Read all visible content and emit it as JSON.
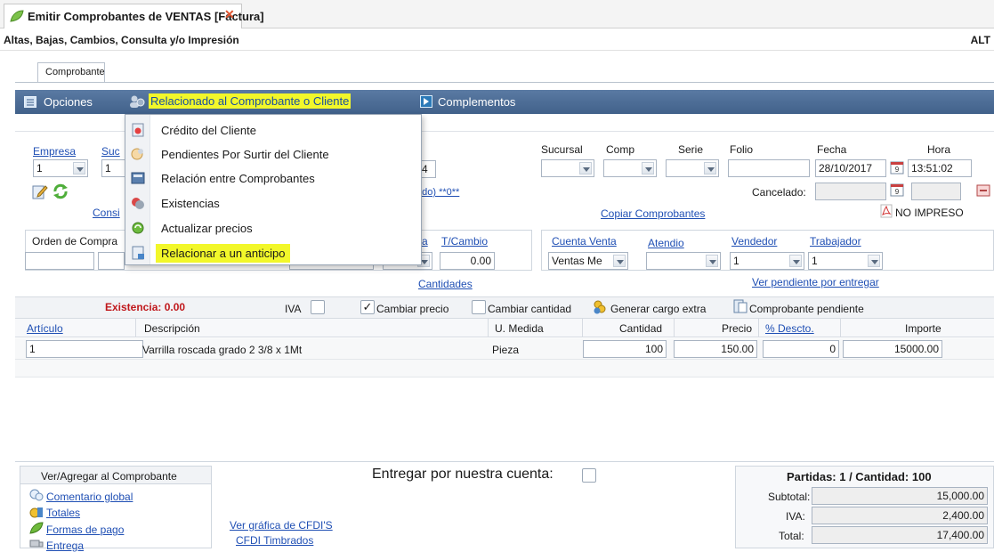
{
  "window": {
    "title": "Emitir Comprobantes de VENTAS [Factura]",
    "subtitle": "Altas, Bajas, Cambios, Consulta y/o Impresión",
    "mode_label": "ALT"
  },
  "tabs": [
    {
      "label": "Comprobante"
    }
  ],
  "toolbar": {
    "opciones": "Opciones",
    "relacionado": "Relacionado al Comprobante o Cliente",
    "complementos": "Complementos"
  },
  "menu": {
    "items": [
      {
        "label": "Crédito del Cliente",
        "icon": "credit-icon"
      },
      {
        "label": "Pendientes Por Surtir del Cliente",
        "icon": "pending-icon"
      },
      {
        "label": "Relación entre Comprobantes",
        "icon": "relation-icon"
      },
      {
        "label": "Existencias",
        "icon": "stock-icon"
      },
      {
        "label": "Actualizar precios",
        "icon": "update-prices-icon"
      },
      {
        "label": "Relacionar a un anticipo",
        "icon": "advance-icon"
      }
    ]
  },
  "header": {
    "empresa_label": "Empresa",
    "empresa_value": "1",
    "sucursal_short_label": "Suc",
    "sucursal_short_value": "1",
    "consig_label": "Consi",
    "hidden_value": "4",
    "status_text": "ado) **0**",
    "sucursal_label": "Sucursal",
    "comp_label": "Comp",
    "serie_label": "Serie",
    "folio_label": "Folio",
    "fecha_label": "Fecha",
    "fecha_value": "28/10/2017",
    "hora_label": "Hora",
    "hora_value": "13:51:02",
    "cancelado_label": "Cancelado:",
    "copiar_link": "Copiar Comprobantes",
    "no_impreso": "NO IMPRESO"
  },
  "row2": {
    "orden_label": "Orden de Compra",
    "a_label": "a",
    "tcambio_label": "T/Cambio",
    "tcambio_value": "0.00",
    "cuenta_venta_label": "Cuenta Venta",
    "cuenta_venta_value": "Ventas Me",
    "atendio_label": "Atendio",
    "vendedor_label": "Vendedor",
    "vendedor_value": "1",
    "trabajador_label": "Trabajador",
    "trabajador_value": "1",
    "cantidades_link": "Cantidades",
    "ver_pendiente_link": "Ver pendiente por entregar"
  },
  "items_toolbar": {
    "existencia": "Existencia: 0.00",
    "iva_label": "IVA",
    "cambiar_precio": "Cambiar precio",
    "cambiar_cantidad": "Cambiar cantidad",
    "generar_cargo": "Generar cargo extra",
    "comprobante_pendiente": "Comprobante pendiente"
  },
  "table": {
    "headers": [
      "Artículo",
      "Descripción",
      "U. Medida",
      "Cantidad",
      "Precio",
      "% Descto.",
      "Importe"
    ],
    "rows": [
      {
        "articulo": "1",
        "descripcion": "Varrilla roscada grado 2 3/8 x 1Mt",
        "unidad": "Pieza",
        "cantidad": "100",
        "precio": "150.00",
        "descuento": "0",
        "importe": "15000.00"
      }
    ]
  },
  "footer": {
    "ver_agregar_title": "Ver/Agregar al Comprobante",
    "comentario_link": "Comentario global",
    "totales_link": "Totales",
    "formas_pago_link": "Formas de pago",
    "entrega_link": "Entrega",
    "ver_grafica_link": "Ver gráfica de CFDI'S",
    "cfdi_timbrados_link": "CFDI Timbrados",
    "entregar_label": "Entregar por nuestra cuenta:",
    "partidas": "Partidas: 1 / Cantidad: 100",
    "subtotal_label": "Subtotal:",
    "subtotal_value": "15,000.00",
    "iva_label": "IVA:",
    "iva_value": "2,400.00",
    "total_label": "Total:",
    "total_value": "17,400.00"
  },
  "colors": {
    "toolbar_bg": "#4a6990",
    "highlight": "#f2f72a",
    "red_text": "#c0181c",
    "link": "#1f4fb4"
  }
}
